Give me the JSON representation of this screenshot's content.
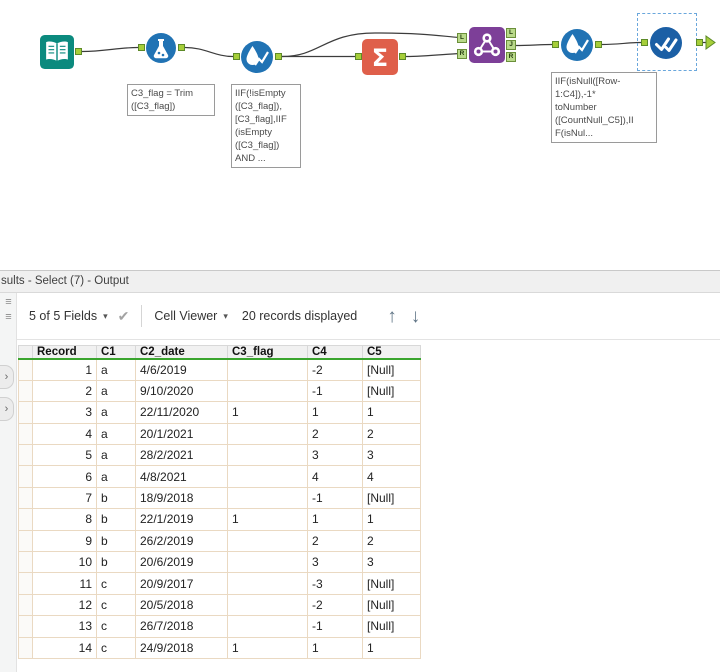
{
  "canvas": {
    "annotations": {
      "formula": "C3_flag = Trim\n([C3_flag])",
      "multirow1": "IIF(!isEmpty\n([C3_flag]),\n[C3_flag],IIF\n(isEmpty\n([C3_flag])\nAND ...",
      "multirow2": "IIF(isNull([Row-\n1:C4]),-1*\ntoNumber\n([CountNull_C5]),II\nF(isNul..."
    },
    "join": {
      "left_anchors": [
        "L",
        "R"
      ],
      "right_anchors": [
        "L",
        "J",
        "R"
      ]
    }
  },
  "results": {
    "title": "sults - Select (7) - Output",
    "toolbar": {
      "fields": "5 of 5 Fields",
      "cell_viewer": "Cell Viewer",
      "records": "20 records displayed",
      "caret": "▾",
      "apply_check": "✔",
      "up_arrow": "↑",
      "down_arrow": "↓"
    },
    "left_strip": {
      "list_icon": "≡",
      "expand_tab": "›"
    },
    "table": {
      "columns": [
        "Record",
        "C1",
        "C2_date",
        "C3_flag",
        "C4",
        "C5"
      ],
      "rows": [
        [
          "1",
          "a",
          "4/6/2019",
          "",
          "-2",
          "[Null]"
        ],
        [
          "2",
          "a",
          "9/10/2020",
          "",
          "-1",
          "[Null]"
        ],
        [
          "3",
          "a",
          "22/11/2020",
          "1",
          "1",
          "1"
        ],
        [
          "4",
          "a",
          "20/1/2021",
          "",
          "2",
          "2"
        ],
        [
          "5",
          "a",
          "28/2/2021",
          "",
          "3",
          "3"
        ],
        [
          "6",
          "a",
          "4/8/2021",
          "",
          "4",
          "4"
        ],
        [
          "7",
          "b",
          "18/9/2018",
          "",
          "-1",
          "[Null]"
        ],
        [
          "8",
          "b",
          "22/1/2019",
          "1",
          "1",
          "1"
        ],
        [
          "9",
          "b",
          "26/2/2019",
          "",
          "2",
          "2"
        ],
        [
          "10",
          "b",
          "20/6/2019",
          "",
          "3",
          "3"
        ],
        [
          "11",
          "c",
          "20/9/2017",
          "",
          "-3",
          "[Null]"
        ],
        [
          "12",
          "c",
          "20/5/2018",
          "",
          "-2",
          "[Null]"
        ],
        [
          "13",
          "c",
          "26/7/2018",
          "",
          "-1",
          "[Null]"
        ],
        [
          "14",
          "c",
          "24/9/2018",
          "1",
          "1",
          "1"
        ]
      ]
    }
  },
  "colors": {
    "connector_green": "#a6ce39",
    "input_teal": "#0b8a7e",
    "formula_blue": "#2173b4",
    "summarize_orange": "#df5f4a",
    "join_purple": "#7d3f98",
    "select_blue": "#1b5fa5",
    "header_accent_green": "#3aa52e",
    "null_text": "#a99a7c"
  }
}
